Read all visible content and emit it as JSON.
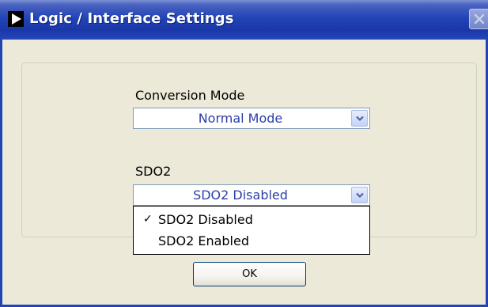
{
  "window": {
    "title": "Logic / Interface Settings"
  },
  "conversion_mode": {
    "label": "Conversion Mode",
    "selected": "Normal Mode"
  },
  "sdo2": {
    "label": "SDO2",
    "selected": "SDO2 Disabled",
    "check_mark": "✓",
    "options": [
      "SDO2 Disabled",
      "SDO2 Enabled"
    ]
  },
  "buttons": {
    "ok_label": "OK"
  },
  "icons": {
    "title": "play-triangle-icon",
    "close": "close-icon",
    "dropdown": "chevron-down-icon"
  },
  "colors": {
    "titlebar": "#2244b6",
    "combo_text": "#2b3fa6",
    "dialog_bg": "#ece9d8"
  }
}
